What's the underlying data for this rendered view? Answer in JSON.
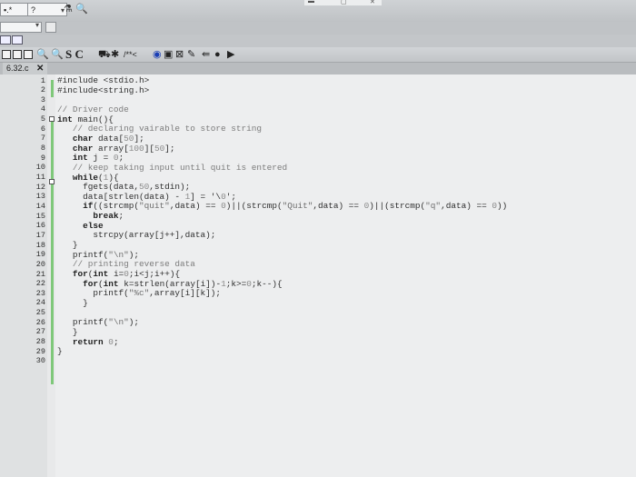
{
  "topbar": {
    "combo1_value": "▪.*",
    "combo2_value": "?",
    "icons": [
      "chemistry-icon",
      "search-icon"
    ]
  },
  "tab": {
    "title": "6.32.c",
    "close": "✕"
  },
  "toolbar": {
    "sc_label": "S C",
    "comment_label": "/**<"
  },
  "editor": {
    "lines": [
      {
        "n": "1",
        "t": "#include <stdio.h>"
      },
      {
        "n": "2",
        "t": "#include<string.h>"
      },
      {
        "n": "3",
        "t": ""
      },
      {
        "n": "4",
        "t": "// Driver code"
      },
      {
        "n": "5",
        "t": "int main(){"
      },
      {
        "n": "6",
        "t": "   // declaring vairable to store string"
      },
      {
        "n": "7",
        "t": "   char data[50];"
      },
      {
        "n": "8",
        "t": "   char array[100][50];"
      },
      {
        "n": "9",
        "t": "   int j = 0;"
      },
      {
        "n": "10",
        "t": "   // keep taking input until quit is entered"
      },
      {
        "n": "11",
        "t": "   while(1){"
      },
      {
        "n": "12",
        "t": "     fgets(data,50,stdin);"
      },
      {
        "n": "13",
        "t": "     data[strlen(data) - 1] = '\\0';"
      },
      {
        "n": "14",
        "t": "     if((strcmp(\"quit\",data) == 0)||(strcmp(\"Quit\",data) == 0)||(strcmp(\"q\",data) == 0))"
      },
      {
        "n": "15",
        "t": "       break;"
      },
      {
        "n": "16",
        "t": "     else"
      },
      {
        "n": "17",
        "t": "       strcpy(array[j++],data);"
      },
      {
        "n": "18",
        "t": "   }"
      },
      {
        "n": "19",
        "t": "   printf(\"\\n\");"
      },
      {
        "n": "20",
        "t": "   // printing reverse data"
      },
      {
        "n": "21",
        "t": "   for(int i=0;i<j;i++){"
      },
      {
        "n": "22",
        "t": "     for(int k=strlen(array[i])-1;k>=0;k--){"
      },
      {
        "n": "23",
        "t": "       printf(\"%c\",array[i][k]);"
      },
      {
        "n": "24",
        "t": "     }"
      },
      {
        "n": "25",
        "t": ""
      },
      {
        "n": "26",
        "t": "   printf(\"\\n\");"
      },
      {
        "n": "27",
        "t": "   }"
      },
      {
        "n": "28",
        "t": "   return 0;"
      },
      {
        "n": "29",
        "t": "}"
      },
      {
        "n": "30",
        "t": ""
      }
    ]
  },
  "colors": {
    "editor_bg": "#edeeef",
    "gutter_bg": "#dfe1e2",
    "change_marker": "#7fc87a"
  }
}
